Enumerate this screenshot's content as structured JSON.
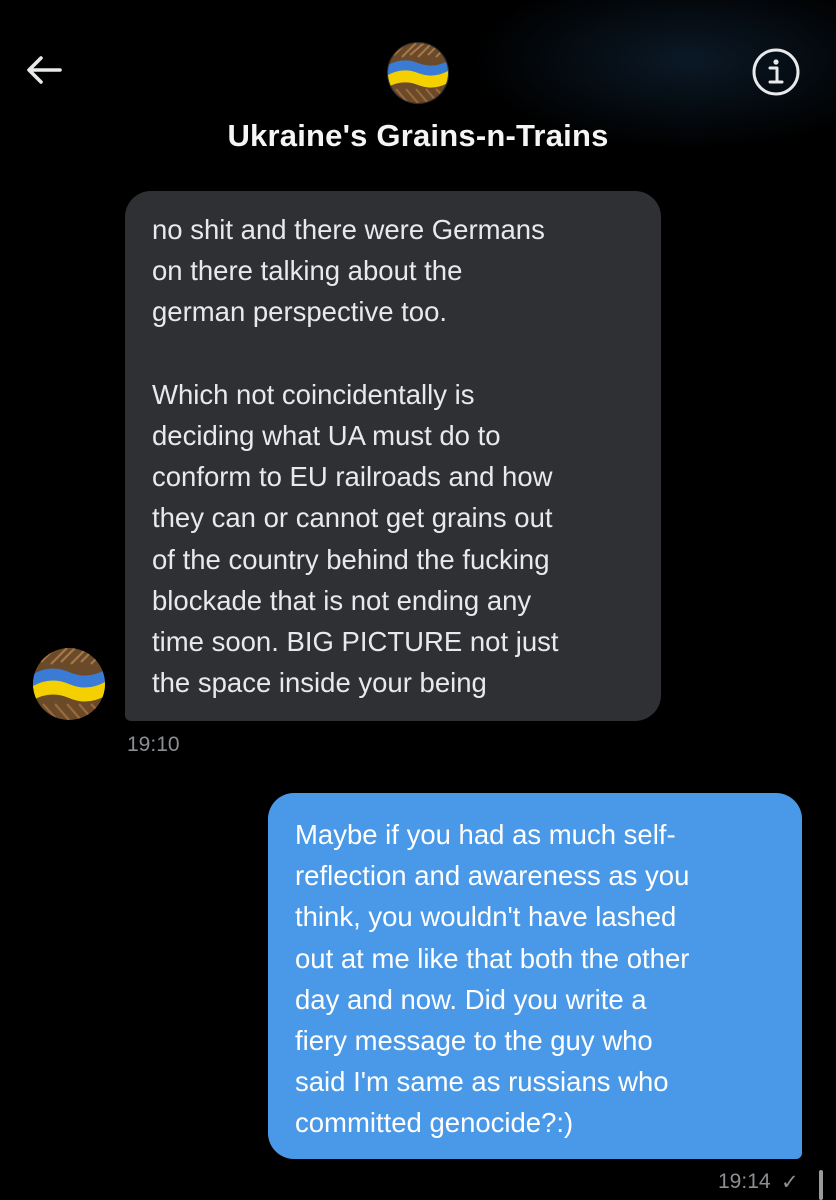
{
  "header": {
    "title": "Ukraine's Grains-n-Trains",
    "back_icon": "arrow-left-icon",
    "info_icon": "info-icon"
  },
  "messages": [
    {
      "direction": "incoming",
      "paragraphs": [
        [
          "no shit and there were Germans",
          "on there talking about the",
          "german perspective too."
        ],
        [
          "Which not coincidentally is",
          "deciding what UA must do to",
          "conform to EU railroads and how",
          "they can or cannot get grains out",
          "of the country behind the fucking",
          "blockade that is not ending any",
          "time soon.  BIG PICTURE not just",
          "the space inside your being"
        ]
      ],
      "time": "19:10"
    },
    {
      "direction": "outgoing",
      "paragraphs": [
        [
          "Maybe if you had as much self-",
          "reflection and awareness as you",
          "think, you wouldn't have lashed",
          "out at me like that both the other",
          "day and now. Did you write a",
          "fiery message to the guy who",
          "said I'm same as russians who",
          "committed genocide?:)"
        ]
      ],
      "time": "19:14",
      "status": "✓"
    }
  ],
  "colors": {
    "background": "#000000",
    "incoming_bubble": "#2f3033",
    "outgoing_bubble": "#4a99e9",
    "timestamp": "#8b8f94"
  }
}
